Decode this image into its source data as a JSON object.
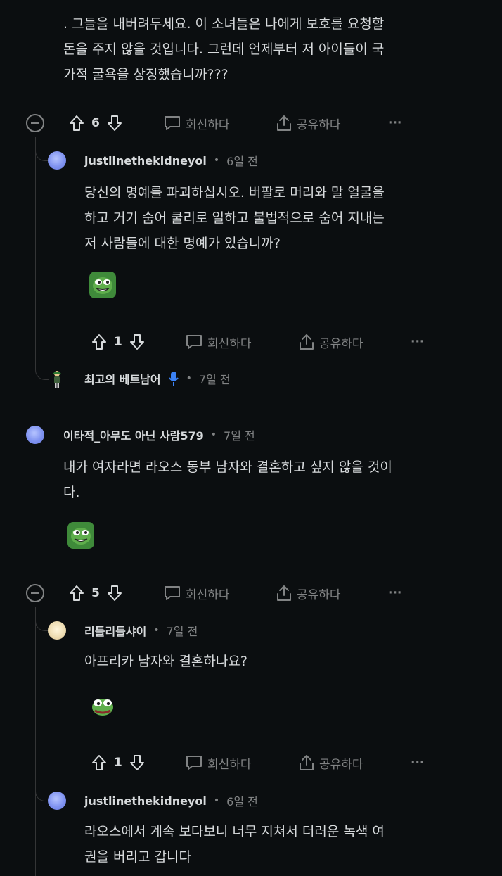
{
  "comments": [
    {
      "id": "top_tail",
      "lines": [
        ". 그들을 내버려두세요. 이 소녀들은 나에게 보호를 요청할",
        "돈을 주지 않을 것입니다. 그런데 언제부터 저 아이들이 국",
        "가적 굴욕을 상징했습니까???"
      ],
      "votes": "6"
    },
    {
      "id": "reply1",
      "username": "justlinethekidneyol",
      "time": "6일 전",
      "lines": [
        "당신의 명예를 파괴하십시오. 버팔로 머리와 말 얼굴을",
        "하고 거기 숨어 쿨리로 일하고 불법적으로 숨어 지내는",
        "저 사람들에 대한 명예가 있습니까?"
      ],
      "votes": "1"
    },
    {
      "id": "reply2",
      "username": "최고의 베트남어",
      "time": "7일 전"
    },
    {
      "id": "comment2",
      "username": "이타적_아무도 아닌 사람579",
      "time": "7일 전",
      "lines": [
        "내가 여자라면 라오스 동부 남자와 결혼하고 싶지 않을 것이",
        "다."
      ],
      "votes": "5"
    },
    {
      "id": "reply3",
      "username": "리틀리틀샤이",
      "time": "7일 전",
      "lines": [
        "아프리카 남자와 결혼하나요?"
      ],
      "votes": "1"
    },
    {
      "id": "reply4",
      "username": "justlinethekidneyol",
      "time": "6일 전",
      "lines": [
        "라오스에서 계속 보다보니 너무 지쳐서 더러운 녹색 여",
        "권을 버리고 갑니다"
      ]
    }
  ],
  "actions": {
    "reply": "회신하다",
    "share": "공유하다",
    "more": "···"
  },
  "separator": "•",
  "icons": [
    "collapse-icon",
    "upvote-icon",
    "downvote-icon",
    "comment-icon",
    "share-icon",
    "more-icon",
    "mic-icon"
  ],
  "colors": {
    "background": "#0b0e10",
    "text": "#d7dadc",
    "muted": "#818384",
    "mic": "#3b82f6"
  }
}
